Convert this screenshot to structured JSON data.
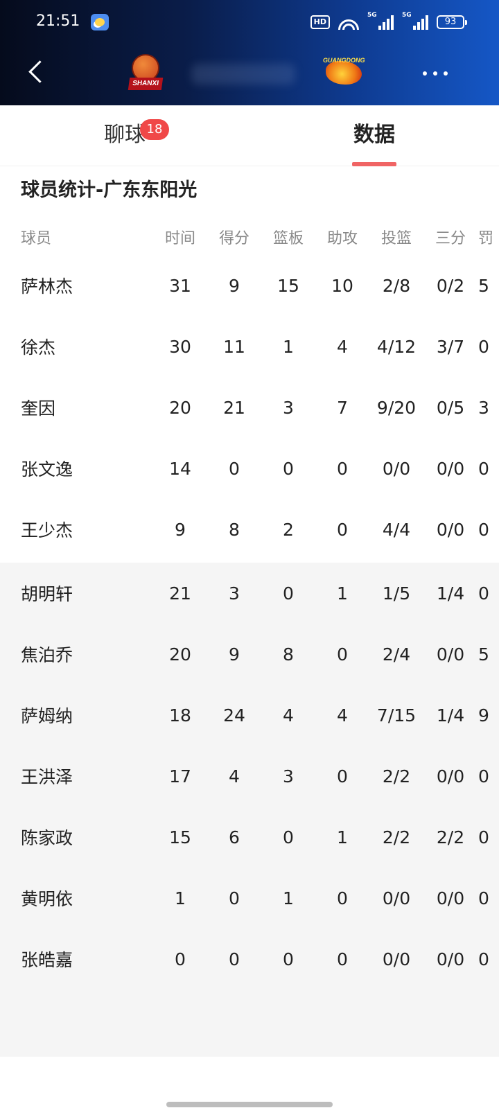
{
  "status_bar": {
    "time": "21:51",
    "hd_label": "HD",
    "signal1_label": "5G",
    "signal2_label": "5G",
    "battery": "93"
  },
  "nav": {
    "home_team_logo_text": "SHANXI",
    "away_team_logo_text": "GUANGDONG"
  },
  "tabs": [
    {
      "label": "聊球",
      "badge": "18",
      "active": false
    },
    {
      "label": "数据",
      "active": true
    }
  ],
  "stats": {
    "title": "球员统计-广东东阳光",
    "columns": [
      "球员",
      "时间",
      "得分",
      "篮板",
      "助攻",
      "投篮",
      "三分",
      "罚"
    ],
    "starters": [
      {
        "name": "萨林杰",
        "time": "31",
        "pts": "9",
        "reb": "15",
        "ast": "10",
        "fg": "2/8",
        "three": "0/2",
        "ft": "5"
      },
      {
        "name": "徐杰",
        "time": "30",
        "pts": "11",
        "reb": "1",
        "ast": "4",
        "fg": "4/12",
        "three": "3/7",
        "ft": "0"
      },
      {
        "name": "奎因",
        "time": "20",
        "pts": "21",
        "reb": "3",
        "ast": "7",
        "fg": "9/20",
        "three": "0/5",
        "ft": "3"
      },
      {
        "name": "张文逸",
        "time": "14",
        "pts": "0",
        "reb": "0",
        "ast": "0",
        "fg": "0/0",
        "three": "0/0",
        "ft": "0"
      },
      {
        "name": "王少杰",
        "time": "9",
        "pts": "8",
        "reb": "2",
        "ast": "0",
        "fg": "4/4",
        "three": "0/0",
        "ft": "0"
      }
    ],
    "bench": [
      {
        "name": "胡明轩",
        "time": "21",
        "pts": "3",
        "reb": "0",
        "ast": "1",
        "fg": "1/5",
        "three": "1/4",
        "ft": "0"
      },
      {
        "name": "焦泊乔",
        "time": "20",
        "pts": "9",
        "reb": "8",
        "ast": "0",
        "fg": "2/4",
        "three": "0/0",
        "ft": "5"
      },
      {
        "name": "萨姆纳",
        "time": "18",
        "pts": "24",
        "reb": "4",
        "ast": "4",
        "fg": "7/15",
        "three": "1/4",
        "ft": "9"
      },
      {
        "name": "王洪泽",
        "time": "17",
        "pts": "4",
        "reb": "3",
        "ast": "0",
        "fg": "2/2",
        "three": "0/0",
        "ft": "0"
      },
      {
        "name": "陈家政",
        "time": "15",
        "pts": "6",
        "reb": "0",
        "ast": "1",
        "fg": "2/2",
        "three": "2/2",
        "ft": "0"
      },
      {
        "name": "黄明依",
        "time": "1",
        "pts": "0",
        "reb": "1",
        "ast": "0",
        "fg": "0/0",
        "three": "0/0",
        "ft": "0"
      },
      {
        "name": "张皓嘉",
        "time": "0",
        "pts": "0",
        "reb": "0",
        "ast": "0",
        "fg": "0/0",
        "three": "0/0",
        "ft": "0"
      }
    ]
  },
  "colors": {
    "accent": "#f06464",
    "badge": "#f04848",
    "header_gradient_start": "#050b1c",
    "header_gradient_end": "#1557c6",
    "bench_background": "#f5f5f5"
  }
}
